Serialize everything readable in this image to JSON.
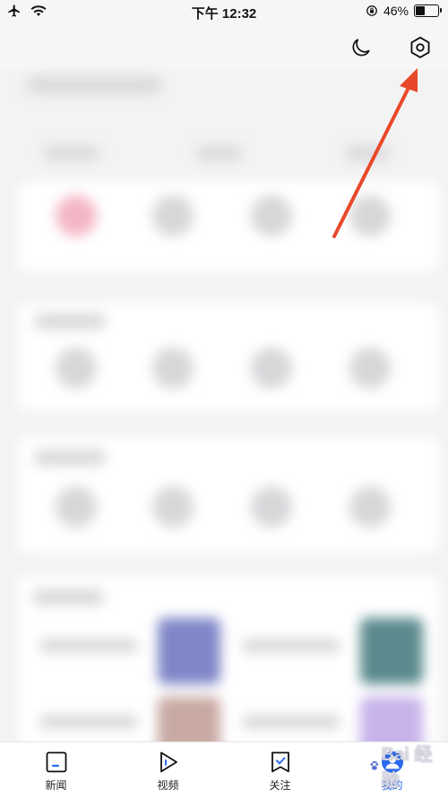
{
  "status_bar": {
    "time": "下午 12:32",
    "battery_text": "46%",
    "battery_level": 0.46,
    "icons": [
      "airplane-icon",
      "wifi-icon",
      "rotation-lock-icon",
      "battery-icon"
    ]
  },
  "header": {
    "icons": [
      "moon-icon",
      "settings-hexagon-icon"
    ]
  },
  "annotation": {
    "color": "#e8492a",
    "shape": "arrow",
    "points_to": "settings-button"
  },
  "tabs": [
    {
      "label": "新闻",
      "icon": "news-icon",
      "active": false
    },
    {
      "label": "视频",
      "icon": "video-play-icon",
      "active": false
    },
    {
      "label": "关注",
      "icon": "follow-bookmark-icon",
      "active": false
    },
    {
      "label": "我的",
      "icon": "mine-icon",
      "active": true
    }
  ],
  "watermark": {
    "text": "Bai 经验",
    "logo": "baidu-paw-logo"
  },
  "colors": {
    "accent": "#2a6bf0",
    "background": "#f3f3f4",
    "arrow": "#e8492a"
  }
}
